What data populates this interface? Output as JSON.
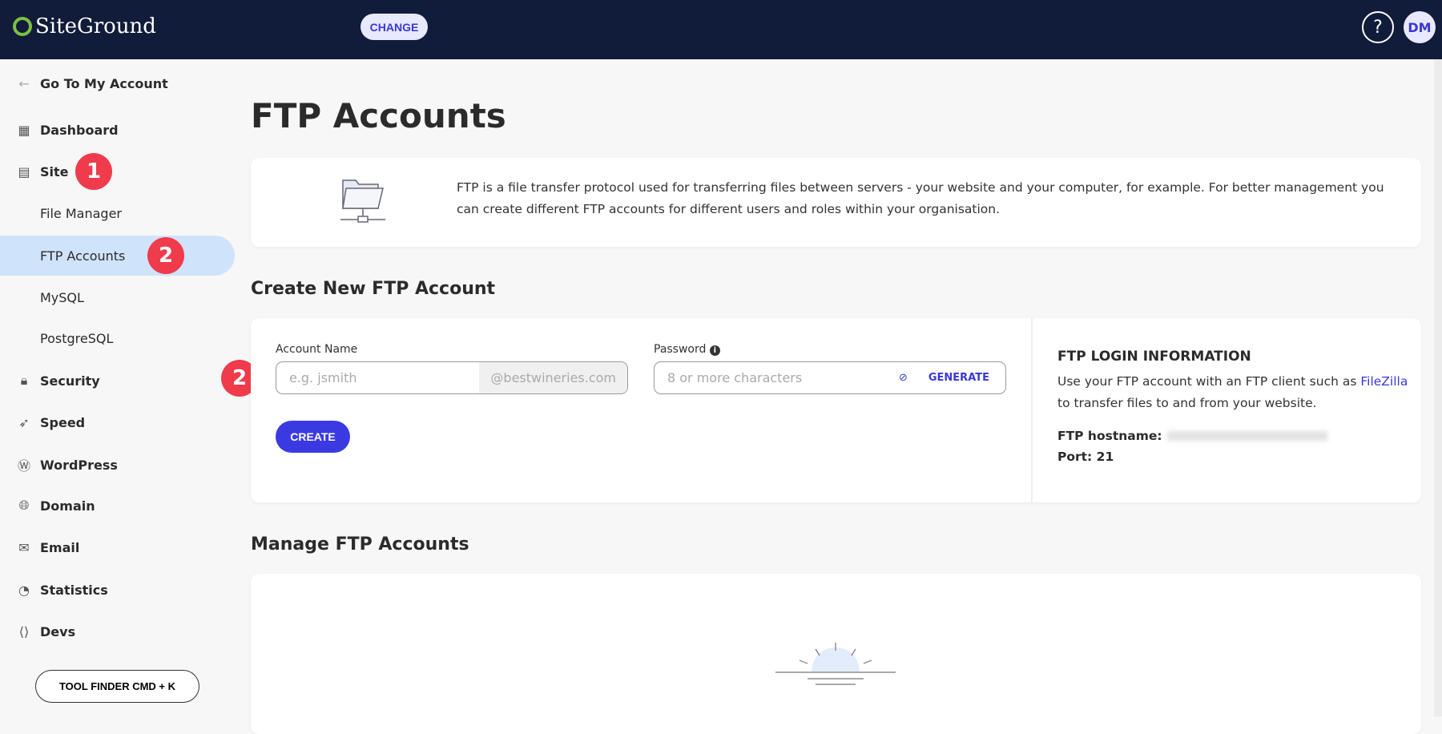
{
  "header": {
    "logo": "SiteGround",
    "change_label": "CHANGE",
    "help": "?",
    "avatar": "DM"
  },
  "sidebar": {
    "back": "Go To My Account",
    "items": [
      {
        "label": "Dashboard",
        "icon": "grid-icon"
      },
      {
        "label": "Site",
        "icon": "site-icon"
      },
      {
        "label": "File Manager"
      },
      {
        "label": "FTP Accounts"
      },
      {
        "label": "MySQL"
      },
      {
        "label": "PostgreSQL"
      },
      {
        "label": "Security",
        "icon": "lock-icon"
      },
      {
        "label": "Speed",
        "icon": "rocket-icon"
      },
      {
        "label": "WordPress",
        "icon": "wordpress-icon"
      },
      {
        "label": "Domain",
        "icon": "globe-icon"
      },
      {
        "label": "Email",
        "icon": "mail-icon"
      },
      {
        "label": "Statistics",
        "icon": "pie-icon"
      },
      {
        "label": "Devs",
        "icon": "code-icon"
      }
    ],
    "tool_finder": "TOOL FINDER CMD + K"
  },
  "annotations": [
    "1",
    "2",
    "2"
  ],
  "main": {
    "title": "FTP Accounts",
    "info": "FTP is a file transfer protocol used for transferring files between servers - your website and your computer, for example. For better management you can create different FTP accounts for different users and roles within your organisation.",
    "create_heading": "Create New FTP Account",
    "account_label": "Account Name",
    "account_placeholder": "e.g. jsmith",
    "domain_suffix": "@bestwineries.com",
    "password_label": "Password",
    "password_placeholder": "8 or more characters",
    "generate": "GENERATE",
    "create": "CREATE",
    "login": {
      "title": "FTP LOGIN INFORMATION",
      "text1": "Use your FTP account with an FTP client such as ",
      "link": "FileZilla",
      "text2": " to transfer files to and from your website.",
      "hostname_label": "FTP hostname:",
      "port": "Port: 21"
    },
    "manage_heading": "Manage FTP Accounts"
  }
}
